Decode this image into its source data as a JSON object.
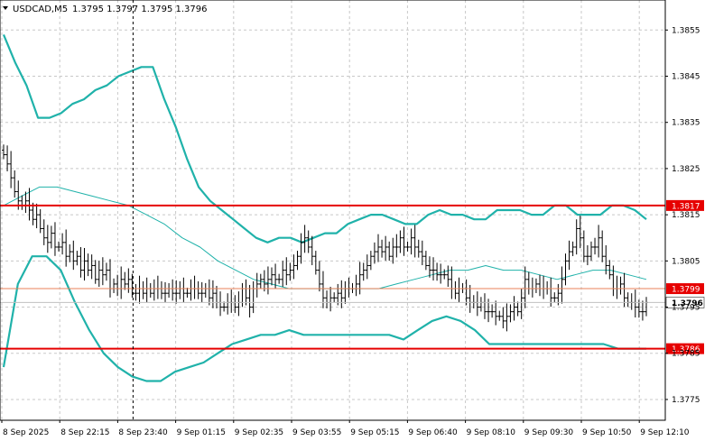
{
  "header": {
    "symbol": "USDCAD,M5",
    "ohlc": "1.3795 1.3797 1.3795 1.3796"
  },
  "colors": {
    "band": "#20b2aa",
    "mid": "#20b2aa",
    "support_resistance": "#e60000",
    "orange_line": "#e8825a",
    "current_line": "#c0c0c0",
    "bar": "#000000",
    "grid": "#c8c8c8"
  },
  "chart_data": {
    "type": "line",
    "title": "",
    "xlabel": "",
    "ylabel": "",
    "ylim": [
      1.37705,
      1.38615
    ],
    "y_ticks": [
      "1.3855",
      "1.3845",
      "1.3835",
      "1.3825",
      "1.3815",
      "1.3805",
      "1.3795",
      "1.3785",
      "1.3775"
    ],
    "x_ticks": [
      "8 Sep 2025",
      "8 Sep 22:15",
      "8 Sep 23:40",
      "9 Sep 01:15",
      "9 Sep 02:35",
      "9 Sep 03:55",
      "9 Sep 05:15",
      "9 Sep 06:40",
      "9 Sep 08:10",
      "9 Sep 09:30",
      "9 Sep 10:50",
      "9 Sep 12:10"
    ],
    "horizontal_lines": [
      {
        "label": "1.3817",
        "value": 1.3817,
        "style": "red-thick"
      },
      {
        "label": "1.3786",
        "value": 1.3786,
        "style": "red-thick"
      },
      {
        "label": "1.3799",
        "value": 1.3799,
        "style": "orange-thin"
      },
      {
        "label": "1.3796",
        "value": 1.3796,
        "style": "current-price"
      }
    ],
    "vertical_marker_bar": 35,
    "bars_count": 176,
    "close": [
      1.3828,
      1.3826,
      1.3823,
      1.382,
      1.3818,
      1.3817,
      1.3818,
      1.3816,
      1.3814,
      1.3815,
      1.3812,
      1.381,
      1.3809,
      1.3811,
      1.3808,
      1.3808,
      1.3809,
      1.3806,
      1.3807,
      1.3805,
      1.3806,
      1.3803,
      1.3805,
      1.3803,
      1.3804,
      1.3801,
      1.3803,
      1.3802,
      1.3803,
      1.3799,
      1.38,
      1.3799,
      1.3801,
      1.38,
      1.3801,
      1.3798,
      1.3798,
      1.3799,
      1.3798,
      1.3799,
      1.3798,
      1.3799,
      1.3799,
      1.3798,
      1.3798,
      1.3799,
      1.3798,
      1.3798,
      1.3799,
      1.3798,
      1.3798,
      1.3799,
      1.3799,
      1.3798,
      1.3798,
      1.3799,
      1.3797,
      1.3798,
      1.3796,
      1.3795,
      1.3795,
      1.3796,
      1.3796,
      1.3795,
      1.3796,
      1.3799,
      1.3797,
      1.3795,
      1.3799,
      1.38,
      1.3801,
      1.38,
      1.3801,
      1.3802,
      1.3801,
      1.3801,
      1.3803,
      1.3802,
      1.3803,
      1.3804,
      1.3806,
      1.3809,
      1.381,
      1.3808,
      1.3806,
      1.3803,
      1.38,
      1.3797,
      1.3796,
      1.3797,
      1.3797,
      1.3798,
      1.3797,
      1.3799,
      1.3799,
      1.3799,
      1.38,
      1.3802,
      1.3803,
      1.3804,
      1.3806,
      1.3807,
      1.3808,
      1.3807,
      1.3808,
      1.3806,
      1.3808,
      1.3808,
      1.381,
      1.3808,
      1.3808,
      1.381,
      1.3808,
      1.3807,
      1.3806,
      1.3804,
      1.3803,
      1.3803,
      1.3802,
      1.3802,
      1.3802,
      1.3801,
      1.3799,
      1.3798,
      1.3799,
      1.3799,
      1.3797,
      1.3796,
      1.3796,
      1.3795,
      1.3796,
      1.3794,
      1.3794,
      1.3794,
      1.3793,
      1.3793,
      1.3792,
      1.3793,
      1.3794,
      1.3795,
      1.3794,
      1.3797,
      1.3801,
      1.3799,
      1.3799,
      1.38,
      1.3799,
      1.3799,
      1.3799,
      1.3797,
      1.3797,
      1.3798,
      1.3801,
      1.3805,
      1.3807,
      1.3808,
      1.3812,
      1.381,
      1.3806,
      1.3806,
      1.3808,
      1.3808,
      1.381,
      1.3806,
      1.3804,
      1.3802,
      1.3799,
      1.3799,
      1.38,
      1.3797,
      1.3796,
      1.3796,
      1.3795,
      1.3794,
      1.3794,
      1.3796
    ],
    "upper_band": [
      1.3854,
      1.3848,
      1.3843,
      1.3836,
      1.3836,
      1.3837,
      1.3839,
      1.384,
      1.3842,
      1.3843,
      1.3845,
      1.3846,
      1.3847,
      1.3847,
      1.384,
      1.3834,
      1.3827,
      1.3821,
      1.3818,
      1.3816,
      1.3814,
      1.3812,
      1.381,
      1.3809,
      1.381,
      1.381,
      1.3809,
      1.381,
      1.3811,
      1.3811,
      1.3813,
      1.3814,
      1.3815,
      1.3815,
      1.3814,
      1.3813,
      1.3813,
      1.3815,
      1.3816,
      1.3815,
      1.3815,
      1.3814,
      1.3814,
      1.3816,
      1.3816,
      1.3816,
      1.3815,
      1.3815,
      1.3817,
      1.3817,
      1.3815,
      1.3815,
      1.3815,
      1.3817,
      1.3817,
      1.3816,
      1.3814
    ],
    "lower_band": [
      1.3782,
      1.38,
      1.3806,
      1.3806,
      1.3803,
      1.3796,
      1.379,
      1.3785,
      1.3782,
      1.378,
      1.3779,
      1.3779,
      1.3781,
      1.3782,
      1.3783,
      1.3785,
      1.3787,
      1.3788,
      1.3789,
      1.3789,
      1.379,
      1.3789,
      1.3789,
      1.3789,
      1.3789,
      1.3789,
      1.3789,
      1.3789,
      1.3788,
      1.379,
      1.3792,
      1.3793,
      1.3792,
      1.379,
      1.3787,
      1.3787,
      1.3787,
      1.3787,
      1.3787,
      1.3787,
      1.3787,
      1.3787,
      1.3787,
      1.3786,
      1.3786,
      1.3786
    ],
    "middle_band": [
      1.3817,
      1.3819,
      1.3821,
      1.3821,
      1.382,
      1.3819,
      1.3818,
      1.3817,
      1.3815,
      1.3813,
      1.381,
      1.3808,
      1.3805,
      1.3803,
      1.3801,
      1.38,
      1.3799,
      1.3799,
      1.3799,
      1.3799,
      1.3799,
      1.3799,
      1.38,
      1.3801,
      1.3802,
      1.3803,
      1.3803,
      1.3804,
      1.3803,
      1.3803,
      1.3802,
      1.3801,
      1.3802,
      1.3803,
      1.3803,
      1.3802,
      1.3801
    ]
  }
}
